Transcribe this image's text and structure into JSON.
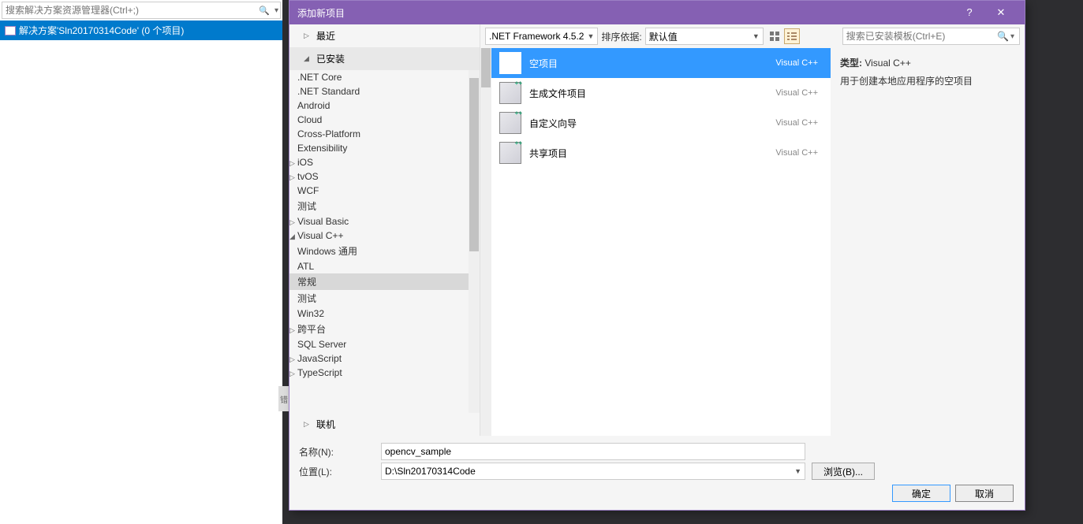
{
  "solexp": {
    "search_placeholder": "搜索解决方案资源管理器(Ctrl+;)",
    "solution_label": "解决方案'Sln20170314Code' (0 个项目)"
  },
  "errtab": "错",
  "dialog": {
    "title": "添加新项目",
    "help": "?",
    "close": "✕",
    "toolbar": {
      "framework": ".NET Framework 4.5.2",
      "sort_label": "排序依据:",
      "sort_value": "默认值",
      "search_placeholder": "搜索已安装模板(Ctrl+E)"
    },
    "sections": {
      "recent": "最近",
      "installed": "已安装",
      "online": "联机"
    },
    "tree": [
      {
        "label": ".NET Core",
        "indent": 1
      },
      {
        "label": ".NET Standard",
        "indent": 1
      },
      {
        "label": "Android",
        "indent": 1
      },
      {
        "label": "Cloud",
        "indent": 1
      },
      {
        "label": "Cross-Platform",
        "indent": 1
      },
      {
        "label": "Extensibility",
        "indent": 1
      },
      {
        "label": "iOS",
        "indent": 1,
        "exp": true
      },
      {
        "label": "tvOS",
        "indent": 1,
        "exp": true
      },
      {
        "label": "WCF",
        "indent": 1
      },
      {
        "label": "测试",
        "indent": 1
      },
      {
        "label": "Visual Basic",
        "indent": 0,
        "exp": true
      },
      {
        "label": "Visual C++",
        "indent": 0,
        "exp": true,
        "open": true
      },
      {
        "label": "Windows 通用",
        "indent": 1
      },
      {
        "label": "ATL",
        "indent": 1
      },
      {
        "label": "常规",
        "indent": 1,
        "selected": true
      },
      {
        "label": "测试",
        "indent": 1
      },
      {
        "label": "Win32",
        "indent": 1
      },
      {
        "label": "跨平台",
        "indent": 1,
        "exp": true
      },
      {
        "label": "SQL Server",
        "indent": 0
      },
      {
        "label": "JavaScript",
        "indent": 0,
        "exp": true
      },
      {
        "label": "TypeScript",
        "indent": 0,
        "exp": true
      }
    ],
    "templates": [
      {
        "name": "空项目",
        "lang": "Visual C++",
        "selected": true
      },
      {
        "name": "生成文件项目",
        "lang": "Visual C++"
      },
      {
        "name": "自定义向导",
        "lang": "Visual C++"
      },
      {
        "name": "共享项目",
        "lang": "Visual C++"
      }
    ],
    "info": {
      "type_label": "类型:",
      "type_value": "Visual C++",
      "desc": "用于创建本地应用程序的空项目"
    },
    "form": {
      "name_label": "名称(N):",
      "name_value": "opencv_sample",
      "loc_label": "位置(L):",
      "loc_value": "D:\\Sln20170314Code",
      "browse": "浏览(B)...",
      "ok": "确定",
      "cancel": "取消"
    }
  }
}
